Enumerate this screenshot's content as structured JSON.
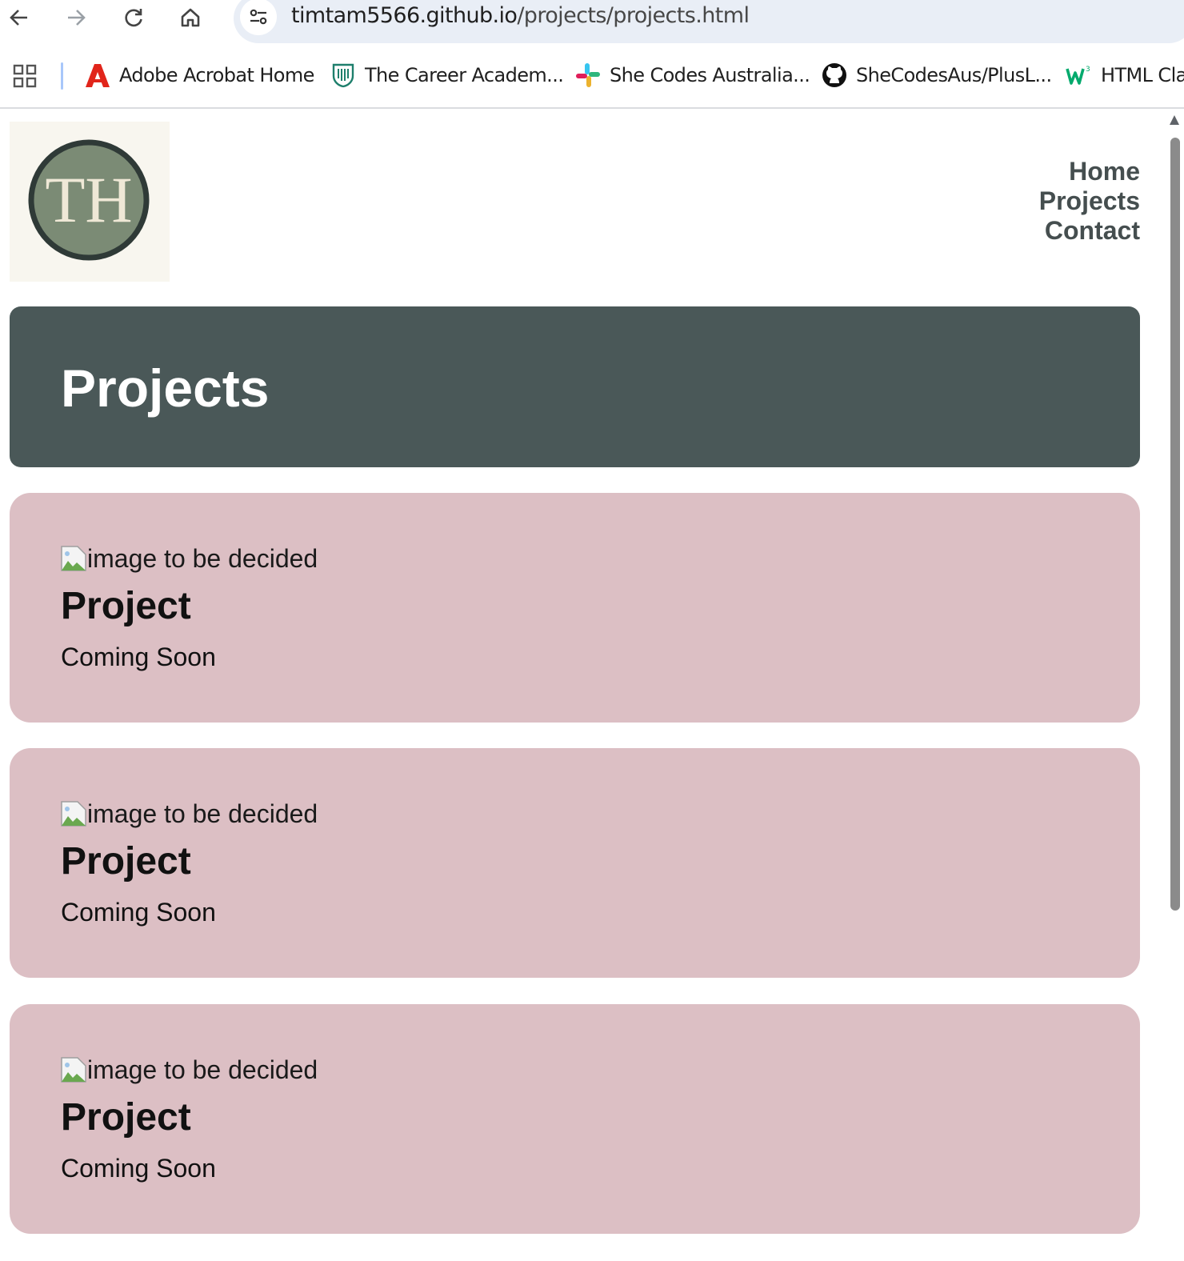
{
  "browser": {
    "url_host": "timtam5566.github.io",
    "url_path": "/projects/projects.html",
    "bookmarks": [
      {
        "label": "Adobe Acrobat Home",
        "icon": "adobe-acrobat-icon"
      },
      {
        "label": "The Career Academ...",
        "icon": "career-academy-icon"
      },
      {
        "label": "She Codes Australia...",
        "icon": "slack-icon"
      },
      {
        "label": "SheCodesAus/PlusL...",
        "icon": "github-icon"
      },
      {
        "label": "HTML Cla",
        "icon": "w3schools-icon"
      }
    ]
  },
  "site": {
    "logo_text": "TH",
    "nav": [
      "Home",
      "Projects",
      "Contact"
    ],
    "hero_title": "Projects",
    "projects": [
      {
        "image_alt": "image to be decided",
        "title": "Project",
        "status": "Coming Soon"
      },
      {
        "image_alt": "image to be decided",
        "title": "Project",
        "status": "Coming Soon"
      },
      {
        "image_alt": "image to be decided",
        "title": "Project",
        "status": "Coming Soon"
      }
    ]
  },
  "colors": {
    "hero_bg": "#4a5858",
    "card_bg": "#dcbfc4",
    "nav_text": "#454e4f",
    "logo_circle": "#7b8b75"
  }
}
